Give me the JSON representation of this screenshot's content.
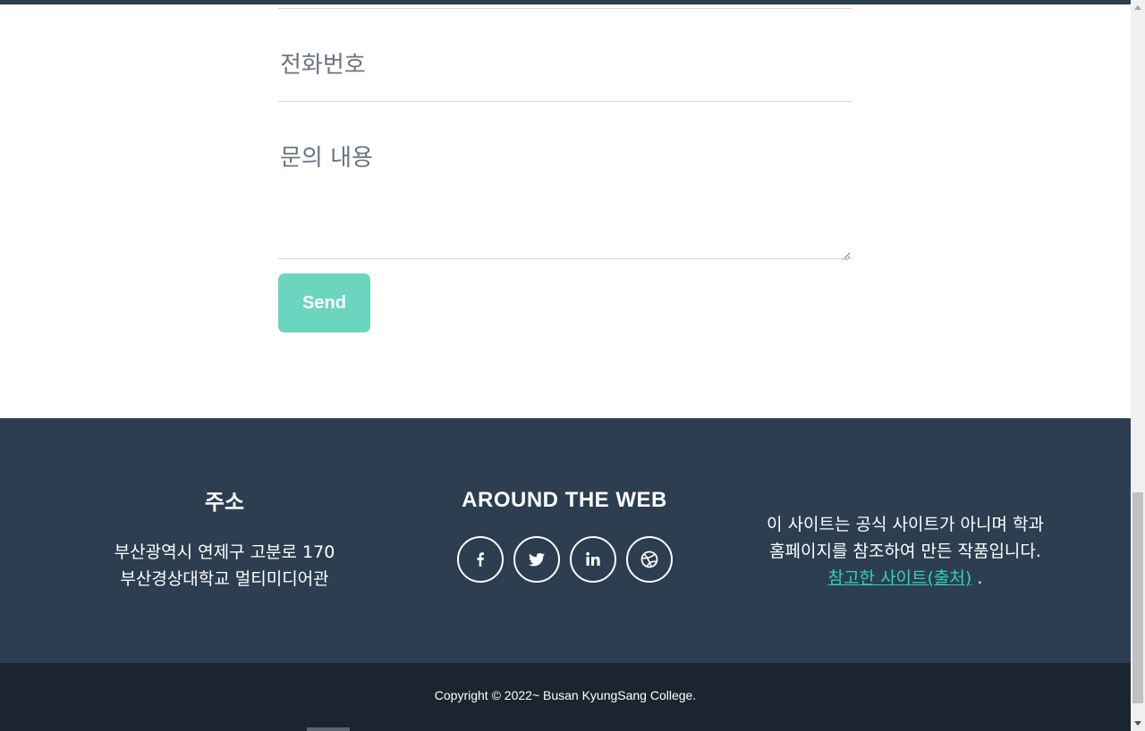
{
  "form": {
    "phone_label": "전화번호",
    "message_label": "문의 내용",
    "send_label": "Send"
  },
  "footer": {
    "address": {
      "heading": "주소",
      "line1": "부산광역시 연제구 고분로 170",
      "line2": "부산경상대학교 멀티미디어관"
    },
    "web": {
      "heading": "AROUND THE WEB",
      "social": [
        {
          "icon": "facebook-icon"
        },
        {
          "icon": "twitter-icon"
        },
        {
          "icon": "linkedin-icon"
        },
        {
          "icon": "dribbble-icon"
        }
      ]
    },
    "about": {
      "line1": "이 사이트는 공식 사이트가 아니며 학과",
      "line2": "홈페이지를 참조하여 만든 작품입니다.",
      "link_label": "참고한 사이트(출처)",
      "trailing": "."
    }
  },
  "copyright": "Copyright © 2022~ Busan KyungSang College.",
  "colors": {
    "accent": "#6bd5bf",
    "link": "#31d3b4",
    "footer_bg": "#2c3e50",
    "copyright_bg": "#1a252f"
  }
}
